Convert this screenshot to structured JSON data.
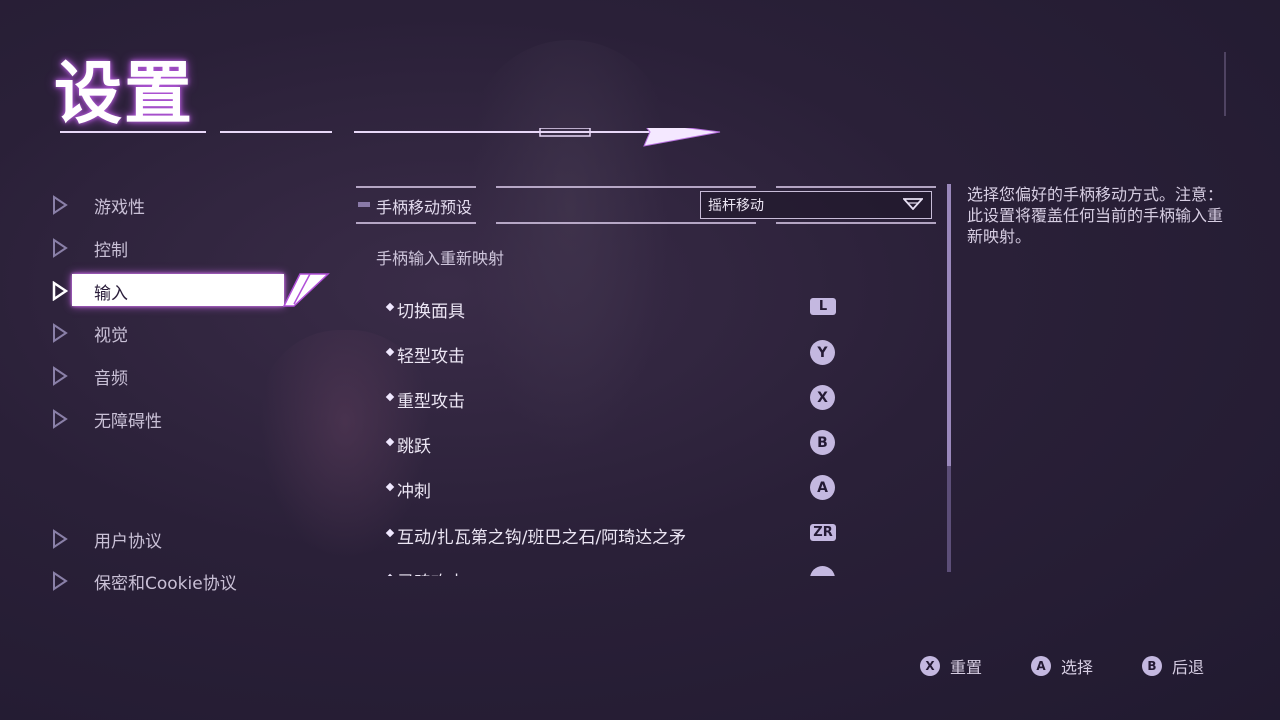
{
  "page": {
    "title": "设置"
  },
  "sidebar": {
    "items": [
      {
        "label": "游戏性"
      },
      {
        "label": "控制"
      },
      {
        "label": "输入"
      },
      {
        "label": "视觉"
      },
      {
        "label": "音频"
      },
      {
        "label": "无障碍性"
      }
    ],
    "bottom_items": [
      {
        "label": "用户协议"
      },
      {
        "label": "保密和Cookie协议"
      }
    ],
    "active_index": 2
  },
  "main": {
    "preset": {
      "label": "手柄移动预设",
      "value": "摇杆移动"
    },
    "remap_header": "手柄输入重新映射",
    "bindings": [
      {
        "label": "切换面具",
        "button": "L"
      },
      {
        "label": "轻型攻击",
        "button": "Y"
      },
      {
        "label": "重型攻击",
        "button": "X"
      },
      {
        "label": "跳跃",
        "button": "B"
      },
      {
        "label": "冲刺",
        "button": "A"
      },
      {
        "label": "互动/扎瓦第之钩/班巴之石/阿琦达之矛",
        "button": "ZR"
      },
      {
        "label": "灵魂攻击",
        "button": ""
      }
    ]
  },
  "description": "选择您偏好的手柄移动方式。注意：此设置将覆盖任何当前的手柄输入重新映射。",
  "footer": {
    "hints": [
      {
        "button": "X",
        "label": "重置"
      },
      {
        "button": "A",
        "label": "选择"
      },
      {
        "button": "B",
        "label": "后退"
      }
    ]
  },
  "colors": {
    "accent_glow": "#c060e0",
    "glyph": "#c4b8e0",
    "background": "#2a2038"
  },
  "icons": {
    "nav": "triangle-arrow-icon",
    "dropdown": "chevron-down-icon"
  }
}
